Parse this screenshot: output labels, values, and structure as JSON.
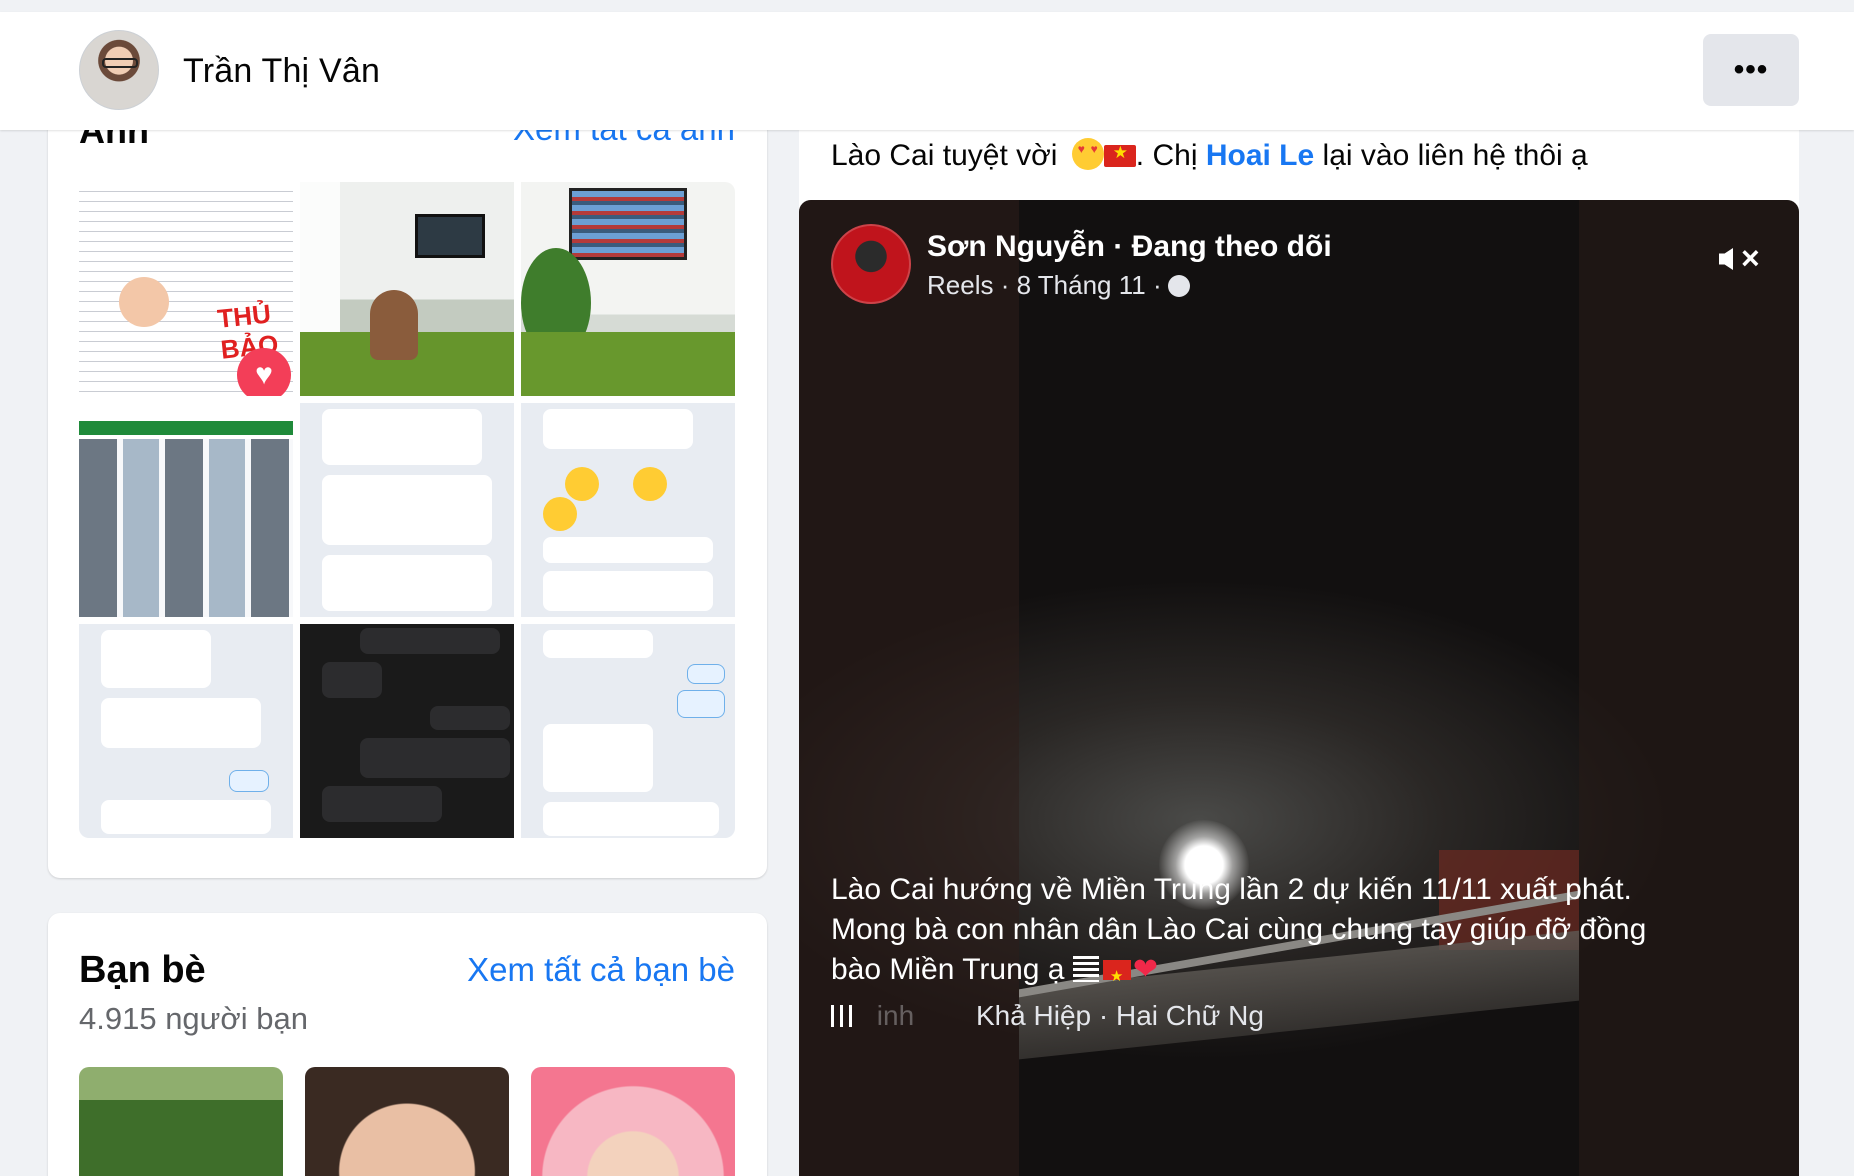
{
  "header": {
    "profile_name": "Trần Thị Vân",
    "more_label": "•••"
  },
  "photos": {
    "title": "Ảnh",
    "see_all": "Xem tất cả ảnh"
  },
  "friends": {
    "title": "Bạn bè",
    "see_all": "Xem tất cả bạn bè",
    "count": "4.915 người bạn"
  },
  "post": {
    "text_before": "Lào Cai tuyệt vời",
    "text_mid": ". Chị",
    "mention": "Hoai Le",
    "text_after": "lại vào liên hệ thôi ạ"
  },
  "video": {
    "author": "Sơn Nguyễn · Đang theo dõi",
    "meta": "Reels · 8 Tháng 11 ·",
    "caption": "Lào Cai hướng về Miền Trung lần 2 dự kiến 11/11 xuất phát. Mong bà con nhân dân Lào Cai cùng chung tay giúp đỡ đồng bào Miền Trung ạ",
    "audio_faded": "inh",
    "audio_text": "Khả Hiệp · Hai Chữ Ng"
  },
  "icons": {
    "more": "more-icon",
    "mute": "mute-icon",
    "globe": "globe-icon",
    "audio": "audio-wave-icon"
  },
  "colors": {
    "link": "#1877f2",
    "background": "#f0f2f5"
  }
}
